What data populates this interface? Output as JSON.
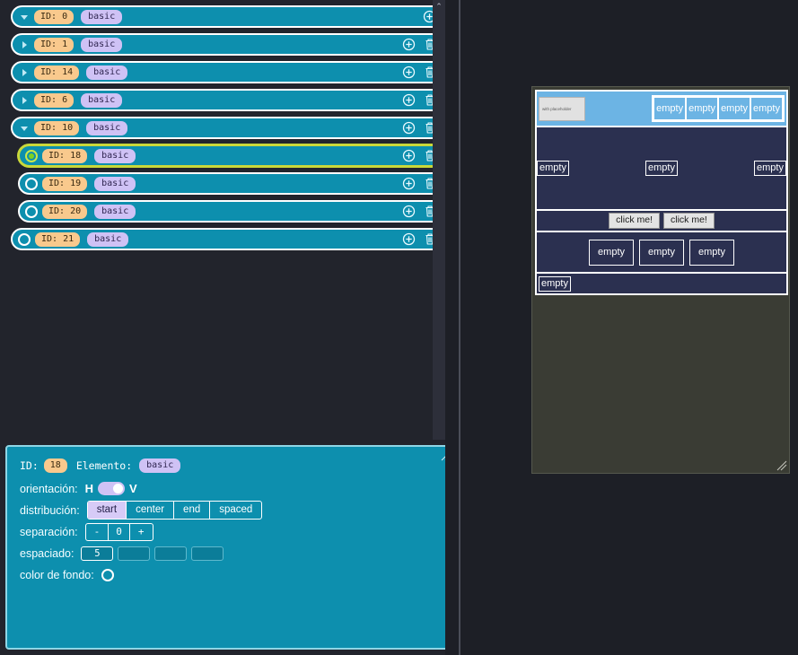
{
  "tree": {
    "rows": [
      {
        "id_label": "ID: 0",
        "type_label": "basic",
        "handle": "caret-down",
        "indent": 0,
        "selected": false,
        "deletable": false
      },
      {
        "id_label": "ID: 1",
        "type_label": "basic",
        "handle": "caret-right",
        "indent": 1,
        "selected": false,
        "deletable": true
      },
      {
        "id_label": "ID: 14",
        "type_label": "basic",
        "handle": "caret-right",
        "indent": 1,
        "selected": false,
        "deletable": true
      },
      {
        "id_label": "ID: 6",
        "type_label": "basic",
        "handle": "caret-right",
        "indent": 1,
        "selected": false,
        "deletable": true
      },
      {
        "id_label": "ID: 10",
        "type_label": "basic",
        "handle": "caret-down",
        "indent": 1,
        "selected": false,
        "deletable": true
      },
      {
        "id_label": "ID: 18",
        "type_label": "basic",
        "handle": "radio-on",
        "indent": 2,
        "selected": true,
        "deletable": true
      },
      {
        "id_label": "ID: 19",
        "type_label": "basic",
        "handle": "radio-off",
        "indent": 2,
        "selected": false,
        "deletable": true
      },
      {
        "id_label": "ID: 20",
        "type_label": "basic",
        "handle": "radio-off",
        "indent": 2,
        "selected": false,
        "deletable": true
      },
      {
        "id_label": "ID: 21",
        "type_label": "basic",
        "handle": "radio-off",
        "indent": 1,
        "selected": false,
        "deletable": true
      }
    ],
    "add_icon": "plus-circle-icon",
    "delete_icon": "trash-icon",
    "scroll_up_glyph": "⌃"
  },
  "properties": {
    "id_text": "ID:",
    "id_value": "18",
    "element_text": "Elemento:",
    "element_value": "basic",
    "orientation": {
      "label": "orientación:",
      "left_option": "H",
      "right_option": "V",
      "selected": "V"
    },
    "distribution": {
      "label": "distribución:",
      "options": [
        "start",
        "center",
        "end",
        "spaced"
      ],
      "selected": "start"
    },
    "separation": {
      "label": "separación:",
      "minus": "-",
      "value": "0",
      "plus": "+"
    },
    "spacing": {
      "label": "espaciado:",
      "values": [
        "5",
        "",
        "",
        ""
      ]
    },
    "background_color": {
      "label": "color de fondo:",
      "swatch": "transparent"
    }
  },
  "preview": {
    "input_placeholder": "with placeholder",
    "top_empties": [
      "empty",
      "empty",
      "empty",
      "empty"
    ],
    "middle_empties": [
      "empty",
      "empty",
      "empty"
    ],
    "buttons": [
      "click me!",
      "click me!"
    ],
    "bottom_empties": [
      "empty",
      "empty",
      "empty"
    ],
    "footer_label": "empty",
    "resize_handle": "resize-grip-icon"
  },
  "colors": {
    "panel_teal": "#0d8fae",
    "badge_id": "#f9c98d",
    "badge_type": "#cfc2f5",
    "selected_outline": "#c9d83a",
    "preview_navy": "#2b3050",
    "preview_topbar": "#6cb4e4",
    "app_background": "#22242c"
  }
}
